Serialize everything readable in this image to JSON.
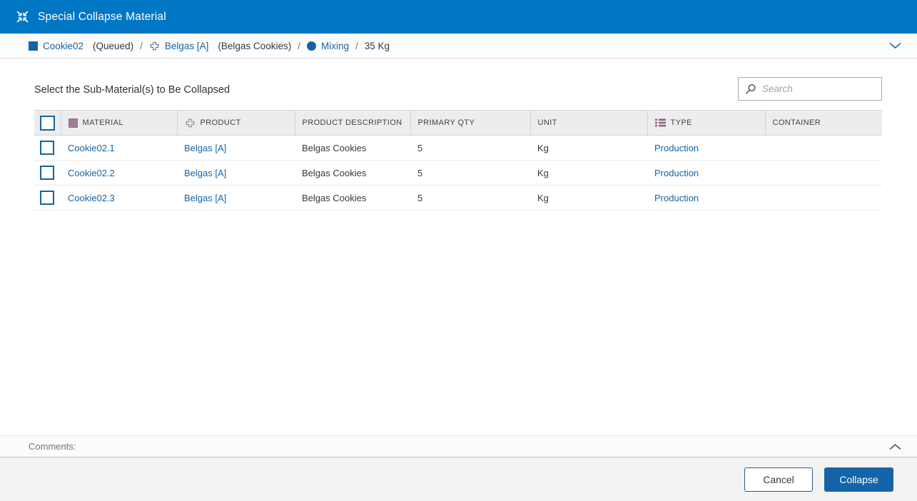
{
  "title_bar": {
    "title": "Special Collapse Material"
  },
  "breadcrumb": {
    "separator": "/",
    "items": [
      {
        "icon": "material-square-icon",
        "label": "Cookie02",
        "suffix": "(Queued)"
      },
      {
        "icon": "product-icon",
        "label": "Belgas [A]",
        "suffix": "(Belgas Cookies)"
      },
      {
        "icon": "operation-circle-icon",
        "label": "Mixing",
        "suffix": ""
      }
    ],
    "quantity": "35 Kg"
  },
  "main": {
    "heading": "Select the Sub-Material(s) to Be Collapsed"
  },
  "search": {
    "placeholder": "Search"
  },
  "table": {
    "columns": [
      {
        "label": "MATERIAL",
        "icon": "material-icon"
      },
      {
        "label": "PRODUCT",
        "icon": "product-icon"
      },
      {
        "label": "PRODUCT DESCRIPTION",
        "icon": null
      },
      {
        "label": "PRIMARY QTY",
        "icon": null
      },
      {
        "label": "UNIT",
        "icon": null
      },
      {
        "label": "TYPE",
        "icon": "type-list-icon"
      },
      {
        "label": "CONTAINER",
        "icon": null
      }
    ],
    "rows": [
      {
        "material": "Cookie02.1",
        "product": "Belgas [A]",
        "product_description": "Belgas Cookies",
        "primary_qty": "5",
        "unit": "Kg",
        "type": "Production",
        "container": ""
      },
      {
        "material": "Cookie02.2",
        "product": "Belgas [A]",
        "product_description": "Belgas Cookies",
        "primary_qty": "5",
        "unit": "Kg",
        "type": "Production",
        "container": ""
      },
      {
        "material": "Cookie02.3",
        "product": "Belgas [A]",
        "product_description": "Belgas Cookies",
        "primary_qty": "5",
        "unit": "Kg",
        "type": "Production",
        "container": ""
      }
    ]
  },
  "comments": {
    "label": "Comments:"
  },
  "footer": {
    "cancel_label": "Cancel",
    "collapse_label": "Collapse"
  },
  "colors": {
    "titlebar": "#0077c5",
    "link": "#1464a5",
    "primary_button": "#1465a7",
    "header_bg": "#ededed"
  }
}
